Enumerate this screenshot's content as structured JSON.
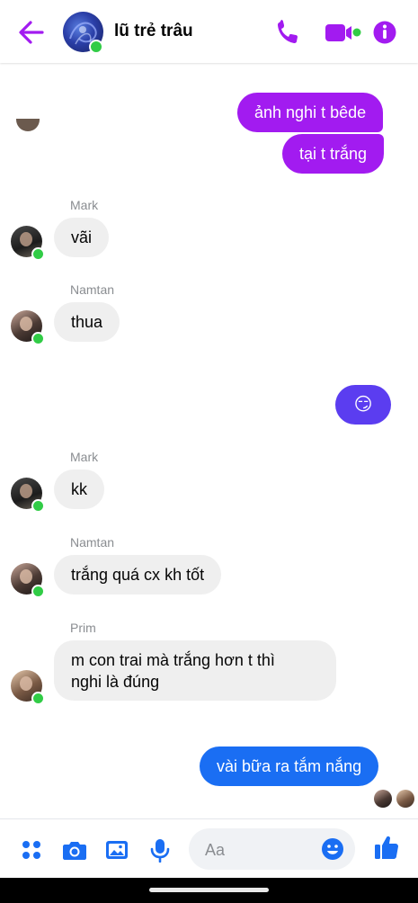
{
  "header": {
    "title": "lũ trẻ trâu"
  },
  "messages": [
    {
      "side": "out",
      "text": "ảnh nghi t bêde"
    },
    {
      "side": "out",
      "text": "tại t trắng"
    },
    {
      "side": "in",
      "sender": "Mark",
      "text": "vãi"
    },
    {
      "side": "in",
      "sender": "Namtan",
      "text": "thua"
    },
    {
      "side": "out",
      "text": "😏"
    },
    {
      "side": "in",
      "sender": "Mark",
      "text": "kk"
    },
    {
      "side": "in",
      "sender": "Namtan",
      "text": "trắng quá cx kh tốt"
    },
    {
      "side": "in",
      "sender": "Prim",
      "text_line1": "m con trai mà trắng hơn t thì",
      "text_line2": "nghi là đúng"
    },
    {
      "side": "out",
      "text": "vài bữa ra tắm nắng"
    }
  ],
  "composer": {
    "placeholder": "Aa"
  },
  "colors": {
    "accent": "#a21bf0",
    "outgoing_bubble": "#a21bf0",
    "outgoing_bubble_last": "#1a6ef3",
    "incoming_bubble": "#efefef",
    "online": "#31cc46"
  },
  "icons": {
    "back": "arrow-left-icon",
    "call": "phone-icon",
    "video": "video-camera-icon",
    "info": "info-icon",
    "menu": "four-dots-icon",
    "camera": "camera-icon",
    "gallery": "image-icon",
    "mic": "microphone-icon",
    "emoji": "emoji-icon",
    "like": "thumbs-up-icon"
  }
}
